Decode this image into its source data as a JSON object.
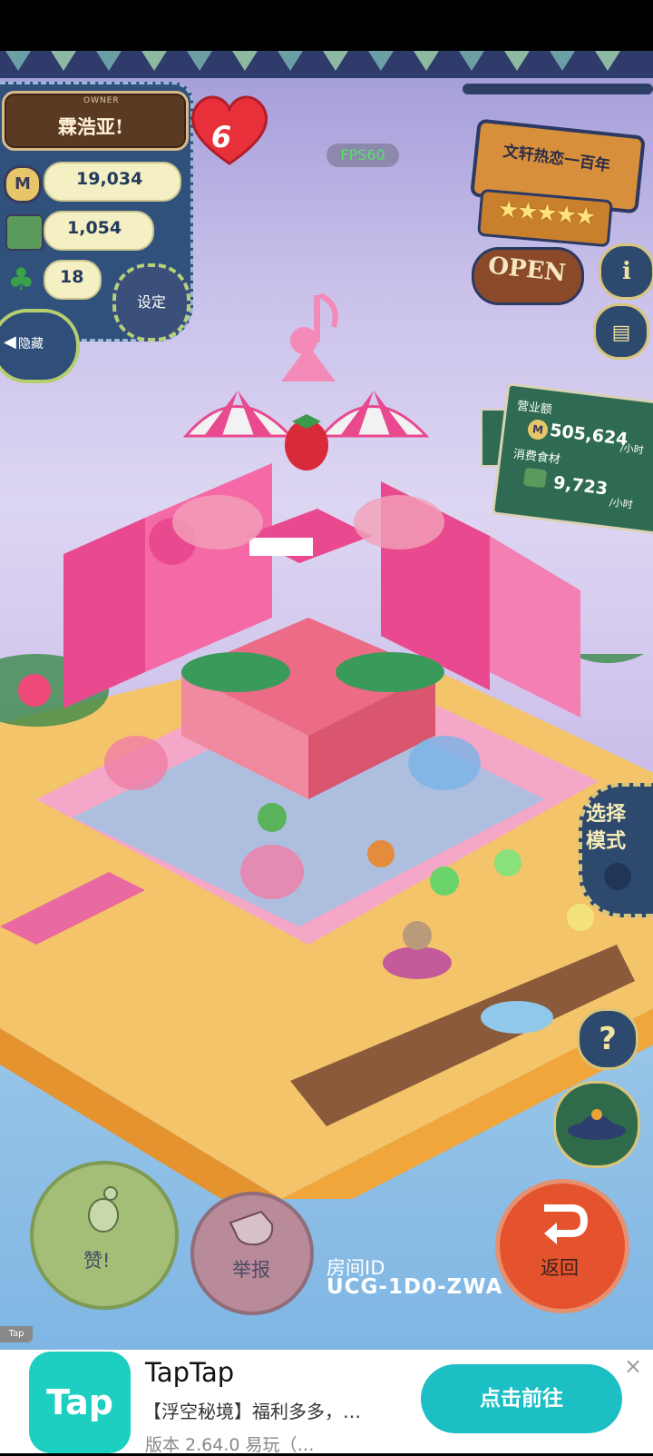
{
  "hud": {
    "owner_small": "OWNER",
    "owner_name": "霖浩亚!",
    "level": "6",
    "coins": "19,034",
    "food": "1,054",
    "clovers": "18",
    "settings_label": "设定",
    "hide_label": "隐藏",
    "fps": "FPS60",
    "coin_symbol": "M"
  },
  "shop": {
    "name": "文轩热恋一百年",
    "rating_stars": "★★★★★",
    "open_label": "OPEN",
    "info_symbol": "i"
  },
  "revenue": {
    "revenue_label": "营业额",
    "revenue_value": "505,624",
    "revenue_unit": "/小时",
    "food_label": "消费食材",
    "food_value": "9,723",
    "food_unit": "/小时"
  },
  "side_buttons": {
    "style_label": "选择模式",
    "help_symbol": "?"
  },
  "bottom": {
    "like_label": "赞!",
    "report_label": "举报",
    "room_id_label": "房间ID",
    "room_id": "UCG-1D0-ZWA",
    "return_label": "返回"
  },
  "ad": {
    "tag": "Tap",
    "logo_text": "Tap",
    "title": "TapTap",
    "description": "【浮空秘境】福利多多，…",
    "version": "版本 2.64.0  易玩（…",
    "cta": "点击前往",
    "close": "×"
  },
  "colors": {
    "accent_pink": "#e94a8f",
    "tile_blue": "#8fc8ea",
    "sand": "#f3c46a",
    "ad_teal": "#1cbfc3"
  }
}
